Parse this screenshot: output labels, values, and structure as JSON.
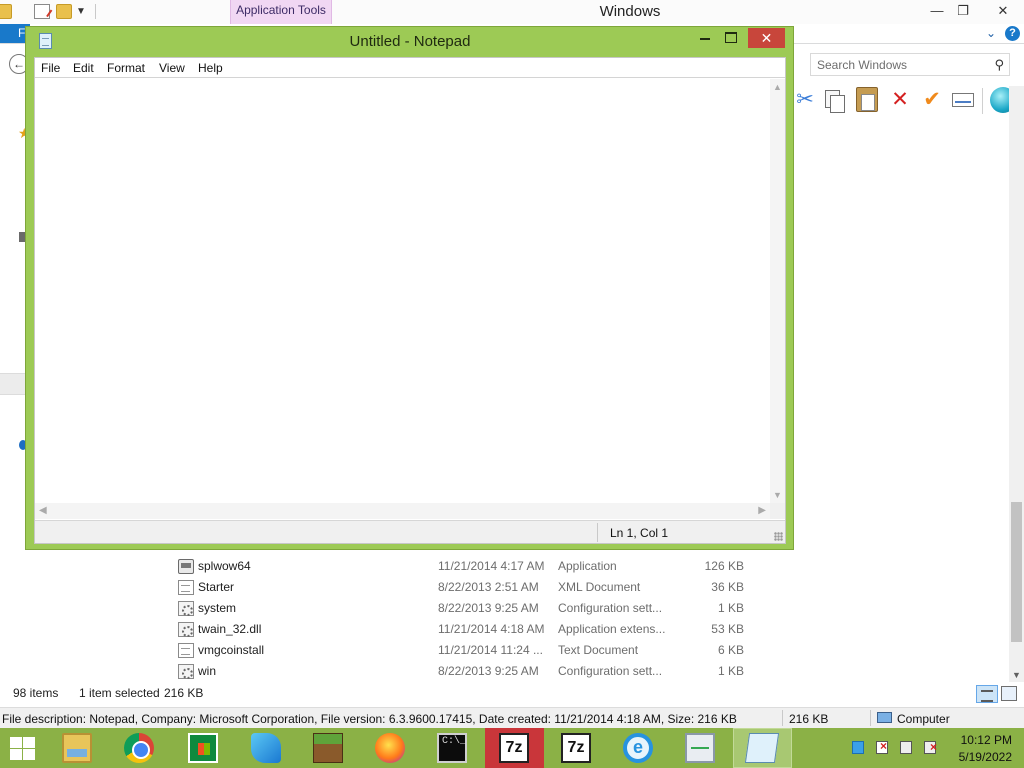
{
  "explorer": {
    "title": "Windows",
    "contextual_tab": "Application Tools",
    "file_tab_label": "F",
    "search_placeholder": "Search Windows",
    "files": [
      {
        "name": "splwow64",
        "date": "11/21/2014 4:17 AM",
        "type": "Application",
        "size": "126 KB",
        "icon": "application-icon"
      },
      {
        "name": "Starter",
        "date": "8/22/2013 2:51 AM",
        "type": "XML Document",
        "size": "36 KB",
        "icon": "xml-document-icon"
      },
      {
        "name": "system",
        "date": "8/22/2013 9:25 AM",
        "type": "Configuration sett...",
        "size": "1 KB",
        "icon": "config-settings-icon"
      },
      {
        "name": "twain_32.dll",
        "date": "11/21/2014 4:18 AM",
        "type": "Application extens...",
        "size": "53 KB",
        "icon": "dll-icon"
      },
      {
        "name": "vmgcoinstall",
        "date": "11/21/2014 11:24 ...",
        "type": "Text Document",
        "size": "6 KB",
        "icon": "text-document-icon"
      },
      {
        "name": "win",
        "date": "8/22/2013 9:25 AM",
        "type": "Configuration sett...",
        "size": "1 KB",
        "icon": "config-settings-icon"
      }
    ],
    "status": {
      "item_count": "98 items",
      "selection": "1 item selected",
      "selection_size": "216 KB"
    },
    "details_bar": {
      "description": "File description: Notepad, Company: Microsoft Corporation, File version: 6.3.9600.17415, Date created: 11/21/2014 4:18 AM, Size: 216 KB",
      "size": "216 KB",
      "location": "Computer"
    }
  },
  "notepad": {
    "title": "Untitled - Notepad",
    "menus": [
      "File",
      "Edit",
      "Format",
      "View",
      "Help"
    ],
    "content": "",
    "cursor_position": "Ln 1, Col 1",
    "close_glyph": "✕"
  },
  "taskbar": {
    "apps": [
      {
        "name": "file-explorer",
        "icon": "folder-icon"
      },
      {
        "name": "google-chrome",
        "icon": "chrome-icon"
      },
      {
        "name": "windows-store",
        "icon": "store-icon"
      },
      {
        "name": "wing-ide",
        "icon": "wing-icon"
      },
      {
        "name": "minecraft",
        "icon": "minecraft-icon"
      },
      {
        "name": "firefox",
        "icon": "firefox-icon"
      },
      {
        "name": "command-prompt",
        "icon": "cmd-icon",
        "label": "C:\\_"
      },
      {
        "name": "7zip-a",
        "icon": "7zip-icon",
        "label": "7z"
      },
      {
        "name": "7zip-b",
        "icon": "7zip-icon",
        "label": "7z"
      },
      {
        "name": "internet-explorer",
        "icon": "ie-icon",
        "label": "e"
      },
      {
        "name": "performance-monitor",
        "icon": "perfmon-icon"
      },
      {
        "name": "notepad",
        "icon": "notepad-icon"
      }
    ],
    "clock": {
      "time": "10:12 PM",
      "date": "5/19/2022"
    }
  },
  "colors": {
    "window_accent": "#9dca55",
    "taskbar": "#8bb146",
    "close_button": "#c8463b",
    "contextual_tab_bg": "#f1d7f3"
  }
}
